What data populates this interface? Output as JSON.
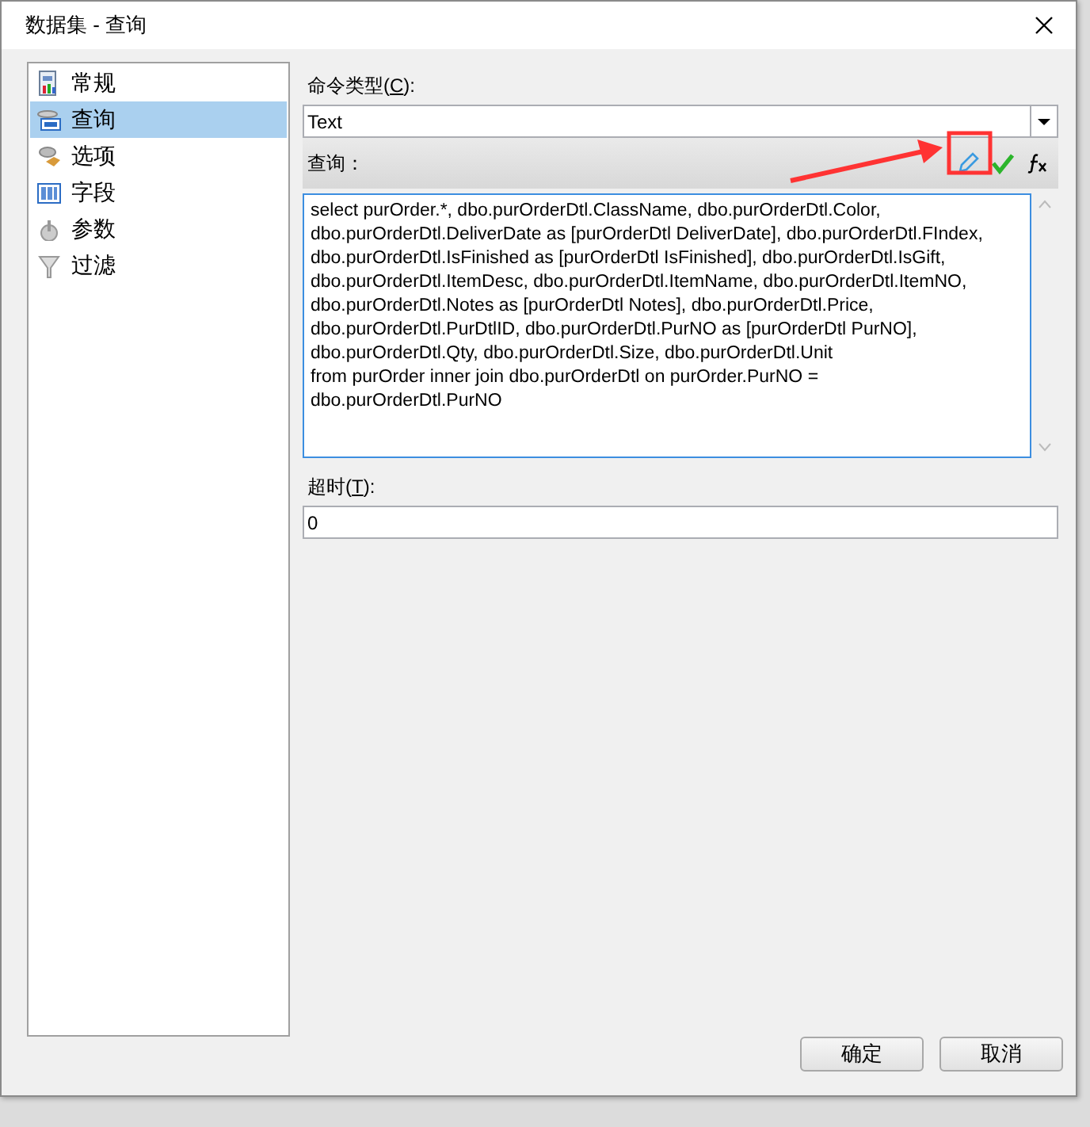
{
  "window": {
    "title": "数据集 - 查询"
  },
  "sidebar": {
    "items": [
      {
        "label": "常规",
        "selected": false
      },
      {
        "label": "查询",
        "selected": true
      },
      {
        "label": "选项",
        "selected": false
      },
      {
        "label": "字段",
        "selected": false
      },
      {
        "label": "参数",
        "selected": false
      },
      {
        "label": "过滤",
        "selected": false
      }
    ]
  },
  "command_type": {
    "label": "命令类型(",
    "mnemonic": "C",
    "label_end": "):",
    "value": "Text"
  },
  "query": {
    "label": "查询：",
    "text": "select purOrder.*, dbo.purOrderDtl.ClassName, dbo.purOrderDtl.Color,\ndbo.purOrderDtl.DeliverDate as [purOrderDtl DeliverDate], dbo.purOrderDtl.FIndex,\ndbo.purOrderDtl.IsFinished as [purOrderDtl IsFinished], dbo.purOrderDtl.IsGift,\ndbo.purOrderDtl.ItemDesc, dbo.purOrderDtl.ItemName, dbo.purOrderDtl.ItemNO,\ndbo.purOrderDtl.Notes as [purOrderDtl Notes], dbo.purOrderDtl.Price,\ndbo.purOrderDtl.PurDtlID, dbo.purOrderDtl.PurNO as [purOrderDtl PurNO],\ndbo.purOrderDtl.Qty, dbo.purOrderDtl.Size, dbo.purOrderDtl.Unit\nfrom purOrder inner join dbo.purOrderDtl on purOrder.PurNO =\ndbo.purOrderDtl.PurNO"
  },
  "timeout": {
    "label": "超时(",
    "mnemonic": "T",
    "label_end": "):",
    "value": "0"
  },
  "buttons": [
    {
      "label": "确定"
    },
    {
      "label": "取消"
    }
  ]
}
